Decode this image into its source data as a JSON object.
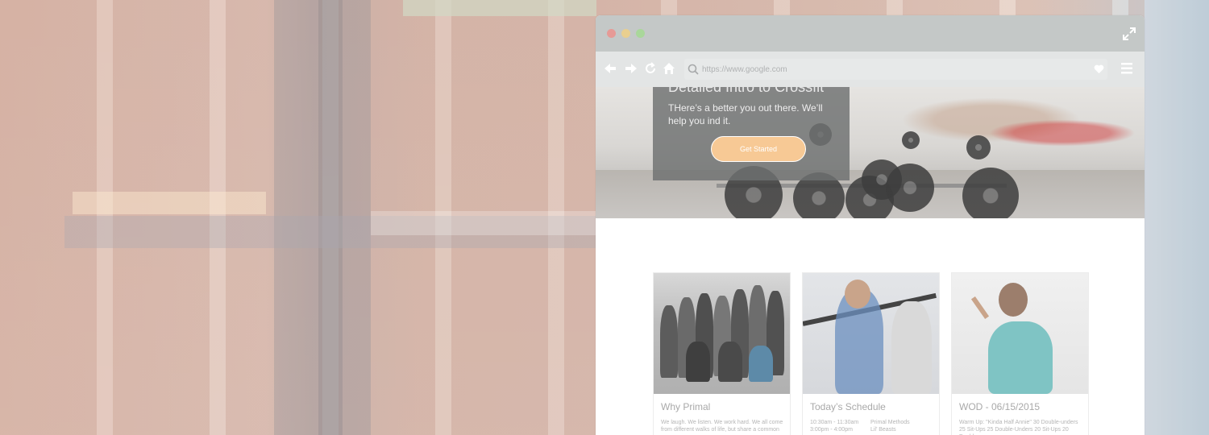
{
  "browser": {
    "url": "https://www.google.com"
  },
  "hero": {
    "title": "Detailed Intro to Crossfit",
    "subtitle": "THere’s a better you out there. We’ll help you ind it.",
    "cta_label": "Get Started"
  },
  "cards": [
    {
      "title": "Why Primal",
      "body": "We laugh. We listen. We work hard. We all come from different walks of life, but share a common"
    },
    {
      "title": "Today’s Schedule",
      "times": [
        "10:30am - 11:30am",
        "3:00pm - 4:00pm"
      ],
      "classes": [
        "Primal Methods",
        "Lil’ Beasts"
      ]
    },
    {
      "title": "WOD - 06/15/2015",
      "body": "Warm Up: \"Kinda Half Annie\" 30 Double-unders 25 Sit-Ups 25 Double-Unders 20 Sit-Ups 20 Double-"
    }
  ],
  "colors": {
    "titlebar": "#c4c8c7",
    "toolbar": "#e3e5e5",
    "cta": "#f7c995",
    "dot_red": "#e69a96",
    "dot_yellow": "#e9cf8f",
    "dot_green": "#a9d79a"
  },
  "icons": {
    "back": "arrow-left-icon",
    "forward": "arrow-right-icon",
    "reload": "reload-icon",
    "home": "home-icon",
    "search": "search-icon",
    "favorite": "heart-icon",
    "menu": "hamburger-menu-icon",
    "fullscreen": "expand-icon"
  }
}
